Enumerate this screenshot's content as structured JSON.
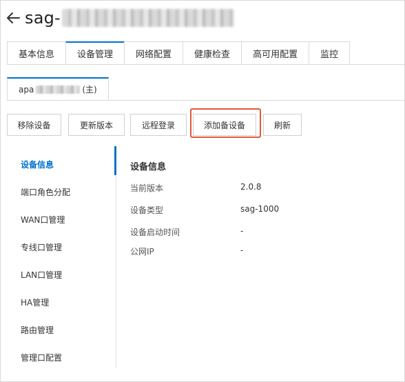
{
  "header": {
    "title_prefix": "sag-",
    "back_icon": "arrow-left-icon"
  },
  "tabs": [
    {
      "label": "基本信息"
    },
    {
      "label": "设备管理",
      "active": true
    },
    {
      "label": "网络配置"
    },
    {
      "label": "健康检查"
    },
    {
      "label": "高可用配置"
    },
    {
      "label": "监控"
    }
  ],
  "subtab": {
    "prefix": "apa",
    "suffix": "(主)"
  },
  "toolbar": {
    "remove_device": "移除设备",
    "update_version": "更新版本",
    "remote_login": "远程登录",
    "add_backup_device": "添加备设备",
    "refresh": "刷新"
  },
  "side_nav": [
    {
      "label": "设备信息",
      "active": true
    },
    {
      "label": "端口角色分配"
    },
    {
      "label": "WAN口管理"
    },
    {
      "label": "专线口管理"
    },
    {
      "label": "LAN口管理"
    },
    {
      "label": "HA管理"
    },
    {
      "label": "路由管理"
    },
    {
      "label": "管理口配置"
    }
  ],
  "device_info": {
    "title": "设备信息",
    "rows": [
      {
        "label": "当前版本",
        "value": "2.0.8"
      },
      {
        "label": "设备类型",
        "value": "sag-1000"
      },
      {
        "label": "设备启动时间",
        "value": "-"
      },
      {
        "label": "公网IP",
        "value": "-"
      }
    ]
  },
  "colors": {
    "accent": "#0070cc",
    "highlight_box": "#e0573a",
    "border": "#d9d9d9"
  }
}
